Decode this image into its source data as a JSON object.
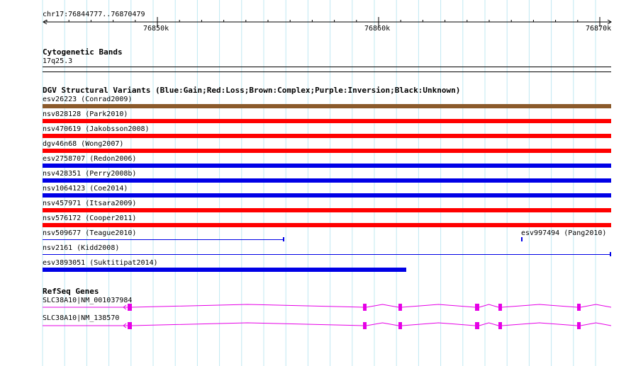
{
  "ruler": {
    "range_label": "chr17:76844777..76870479",
    "ticks": [
      "76850k",
      "76860k",
      "76870k"
    ]
  },
  "cytoband": {
    "title": "Cytogenetic Bands",
    "label": "17q25.3"
  },
  "dgv": {
    "title": "DGV Structural Variants (Blue:Gain;Red:Loss;Brown:Complex;Purple:Inversion;Black:Unknown)",
    "colors": {
      "gain": "#0000e6",
      "loss": "#ff0000",
      "complex": "#8b5a2b"
    },
    "variants": [
      {
        "label": "esv26223 (Conrad2009)",
        "type": "complex"
      },
      {
        "label": "nsv828128 (Park2010)",
        "type": "loss"
      },
      {
        "label": "nsv470619 (Jakobsson2008)",
        "type": "loss"
      },
      {
        "label": "dgv46n68 (Wong2007)",
        "type": "loss"
      },
      {
        "label": "esv2758707 (Redon2006)",
        "type": "gain"
      },
      {
        "label": "nsv428351 (Perry2008b)",
        "type": "gain"
      },
      {
        "label": "nsv1064123 (Coe2014)",
        "type": "gain"
      },
      {
        "label": "nsv457971 (Itsara2009)",
        "type": "loss"
      },
      {
        "label": "nsv576172 (Cooper2011)",
        "type": "loss"
      },
      {
        "label": "nsv509677 (Teague2010)",
        "type": "gain"
      },
      {
        "label": "esv997494 (Pang2010)",
        "type": "gain"
      },
      {
        "label": "nsv2161 (Kidd2008)",
        "type": "gain"
      },
      {
        "label": "esv3893051 (Suktitipat2014)",
        "type": "gain"
      }
    ]
  },
  "refseq": {
    "title": "RefSeq Genes",
    "color": "#e600e6",
    "transcripts": [
      {
        "label": "SLC38A10|NM_001037984"
      },
      {
        "label": "SLC38A10|NM_138570"
      }
    ]
  }
}
